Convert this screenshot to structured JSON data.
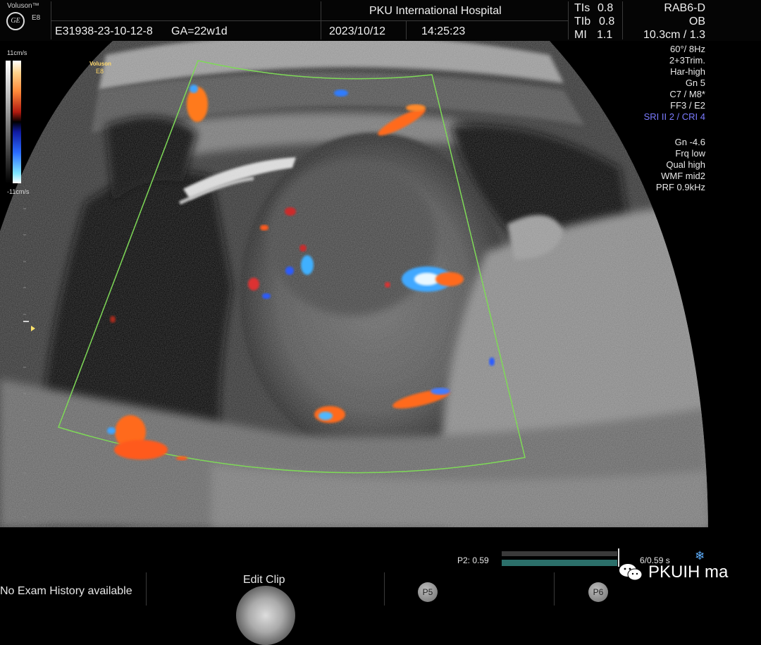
{
  "header": {
    "brand": "Voluson™",
    "model": "E8",
    "logo": "GE",
    "patient_id": "E31938-23-10-12-8",
    "ga": "GA=22w1d",
    "hospital": "PKU International Hospital",
    "date": "2023/10/12",
    "time": "14:25:23",
    "tis_label": "TIs",
    "tis_value": "0.8",
    "tib_label": "TIb",
    "tib_value": "0.8",
    "mi_label": "MI",
    "mi_value": "1.1",
    "probe": "RAB6-D",
    "app": "OB",
    "depth": "10.3cm / 1.3"
  },
  "params": [
    "60°/ 8Hz",
    "2+3Trim.",
    "Har-high",
    "Gn  5",
    "C7 / M8*",
    "FF3 / E2"
  ],
  "params_blue": "SRI II 2 / CRI 4",
  "doppler_params": [
    "Gn -4.6",
    "Frq low",
    "Qual high",
    "WMF mid2",
    "PRF  0.9kHz"
  ],
  "colorbar": {
    "top_label": "11cm/s",
    "bottom_label": "-11cm/s"
  },
  "image_watermark": {
    "brand": "Voluson",
    "model": "E8"
  },
  "cine": {
    "position_label": "P2: 0.59",
    "frame_label": "6/0.59 s",
    "progress": 1.0
  },
  "bottom": {
    "exam_history": "No Exam History available",
    "edit_clip": "Edit Clip",
    "p5": "P5",
    "p6": "P6",
    "watermark": "PKUIH ma"
  },
  "icons": [
    "ge-logo-icon",
    "snowflake-icon",
    "wechat-icon",
    "focus-marker-icon"
  ]
}
